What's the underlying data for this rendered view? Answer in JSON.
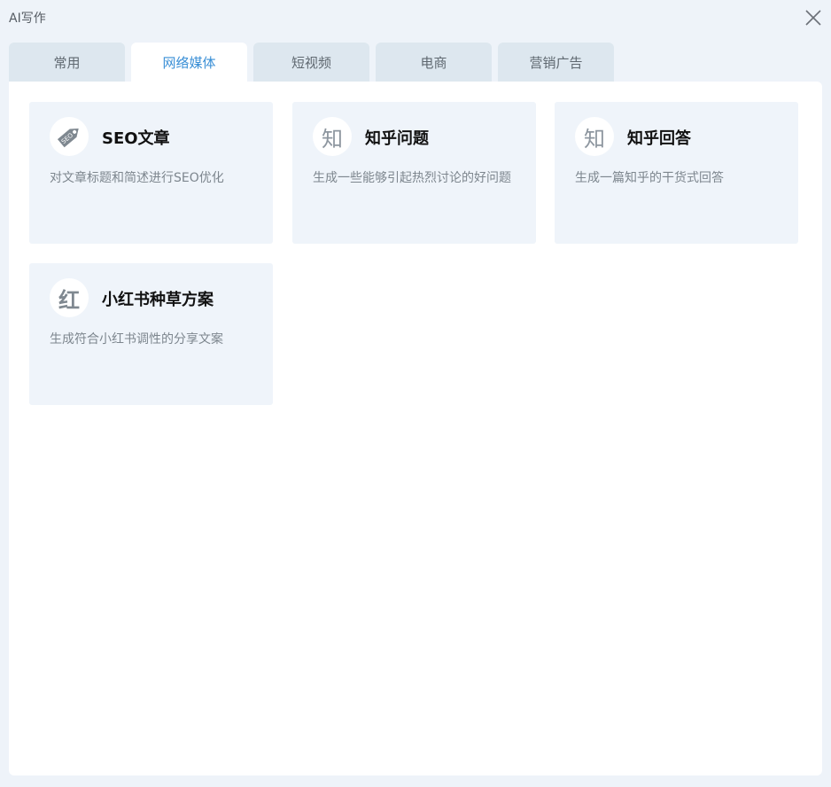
{
  "window": {
    "title": "AI写作"
  },
  "tabs": [
    {
      "label": "常用"
    },
    {
      "label": "网络媒体",
      "active": true
    },
    {
      "label": "短视频"
    },
    {
      "label": "电商"
    },
    {
      "label": "营销广告"
    }
  ],
  "cards": [
    {
      "title": "SEO文章",
      "desc": "对文章标题和简述进行SEO优化",
      "icon": "seo-tag-icon",
      "icon_text": "SEO"
    },
    {
      "title": "知乎问题",
      "desc": "生成一些能够引起热烈讨论的好问题",
      "icon": "zhihu-icon",
      "icon_text": "知"
    },
    {
      "title": "知乎回答",
      "desc": "生成一篇知乎的干货式回答",
      "icon": "zhihu-icon",
      "icon_text": "知"
    },
    {
      "title": "小红书种草方案",
      "desc": "生成符合小红书调性的分享文案",
      "icon": "xiaohongshu-icon",
      "icon_text": "红"
    }
  ],
  "colors": {
    "accent": "#3a8fd6",
    "background": "#eef3f9",
    "card": "#eff4fa",
    "tab_inactive": "#dde7ef"
  }
}
